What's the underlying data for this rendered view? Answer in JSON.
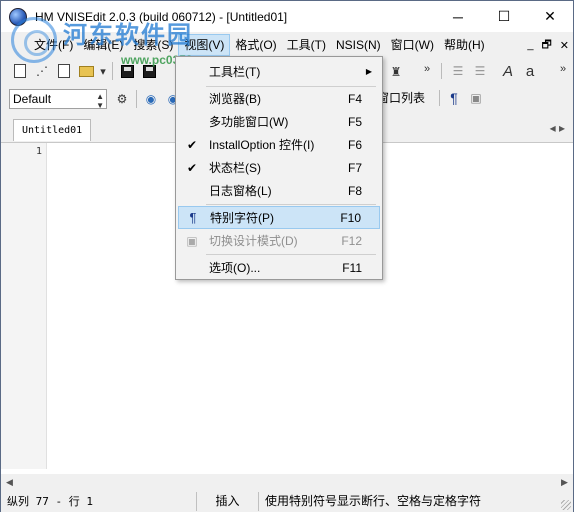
{
  "window": {
    "title": "HM VNISEdit 2.0.3 (build 060712) - [Untitled01]",
    "minimize": "─",
    "maximize": "☐",
    "close": "✕"
  },
  "watermark": {
    "title": "河东软件园",
    "url": "www.pc0359.cn"
  },
  "menubar": {
    "items": [
      "文件(F)",
      "编辑(E)",
      "搜索(S)",
      "视图(V)",
      "格式(O)",
      "工具(T)",
      "NSIS(N)",
      "窗口(W)",
      "帮助(H)"
    ],
    "mdi_min": "_",
    "mdi_restore": "🗗",
    "mdi_close": "✕"
  },
  "toolbar": {
    "style_value": "Default",
    "window_list_label": "窗口列表",
    "pilcrow": "¶",
    "italic_a": "A",
    "small_a": "a",
    "overflow": "»"
  },
  "tabs": {
    "active": "Untitled01"
  },
  "editor": {
    "line_numbers": [
      "1"
    ]
  },
  "view_menu": {
    "items": [
      {
        "label": "工具栏(T)",
        "accel": "",
        "checked": false,
        "submenu": true,
        "disabled": false,
        "highlight": false
      },
      {
        "label": "浏览器(B)",
        "accel": "F4",
        "checked": false,
        "submenu": false,
        "disabled": false,
        "highlight": false
      },
      {
        "label": "多功能窗口(W)",
        "accel": "F5",
        "checked": false,
        "submenu": false,
        "disabled": false,
        "highlight": false
      },
      {
        "label": "InstallOption 控件(I)",
        "accel": "F6",
        "checked": true,
        "submenu": false,
        "disabled": false,
        "highlight": false
      },
      {
        "label": "状态栏(S)",
        "accel": "F7",
        "checked": true,
        "submenu": false,
        "disabled": false,
        "highlight": false
      },
      {
        "label": "日志窗格(L)",
        "accel": "F8",
        "checked": false,
        "submenu": false,
        "disabled": false,
        "highlight": false
      },
      {
        "label": "特别字符(P)",
        "accel": "F10",
        "checked": false,
        "submenu": false,
        "disabled": false,
        "highlight": true
      },
      {
        "label": "切换设计模式(D)",
        "accel": "F12",
        "checked": false,
        "submenu": false,
        "disabled": true,
        "highlight": false
      },
      {
        "label": "选项(O)...",
        "accel": "F11",
        "checked": false,
        "submenu": false,
        "disabled": false,
        "highlight": false
      }
    ]
  },
  "statusbar": {
    "position": "纵列 77 - 行 1",
    "mode": "插入",
    "message": "使用特别符号显示断行、空格与定格字符"
  },
  "colors": {
    "menu_highlight": "#cce4f7",
    "menu_highlight_border": "#99c9ef",
    "watermark_blue": "#1e78d2",
    "watermark_green": "#329646"
  }
}
